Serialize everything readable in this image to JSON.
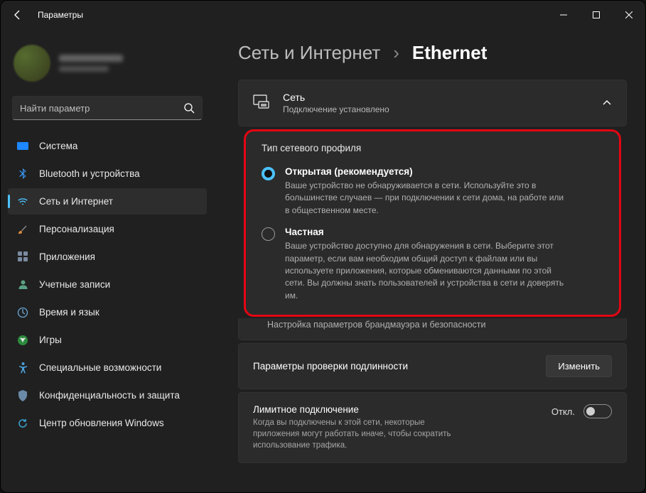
{
  "window": {
    "title": "Параметры"
  },
  "search": {
    "placeholder": "Найти параметр"
  },
  "nav": {
    "items": [
      {
        "label": "Система"
      },
      {
        "label": "Bluetooth и устройства"
      },
      {
        "label": "Сеть и Интернет"
      },
      {
        "label": "Персонализация"
      },
      {
        "label": "Приложения"
      },
      {
        "label": "Учетные записи"
      },
      {
        "label": "Время и язык"
      },
      {
        "label": "Игры"
      },
      {
        "label": "Специальные возможности"
      },
      {
        "label": "Конфиденциальность и защита"
      },
      {
        "label": "Центр обновления Windows"
      }
    ]
  },
  "breadcrumb": {
    "parent": "Сеть и Интернет",
    "sep": "›",
    "current": "Ethernet"
  },
  "net": {
    "title": "Сеть",
    "status": "Подключение установлено"
  },
  "profile_section": {
    "title": "Тип сетевого профиля",
    "public": {
      "label": "Открытая (рекомендуется)",
      "desc": "Ваше устройство не обнаруживается в сети. Используйте это в большинстве случаев — при подключении к сети дома, на работе или в общественном месте."
    },
    "private": {
      "label": "Частная",
      "desc": "Ваше устройство доступно для обнаружения в сети. Выберите этот параметр, если вам необходим общий доступ к файлам или вы используете приложения, которые обмениваются данными по этой сети. Вы должны знать пользователей и устройства в сети и доверять им."
    },
    "firewall_link": "Настройка параметров брандмауэра и безопасности"
  },
  "auth": {
    "label": "Параметры проверки подлинности",
    "button": "Изменить"
  },
  "metered": {
    "label": "Лимитное подключение",
    "desc": "Когда вы подключены к этой сети, некоторые приложения могут работать иначе, чтобы сократить использование трафика.",
    "state": "Откл."
  }
}
